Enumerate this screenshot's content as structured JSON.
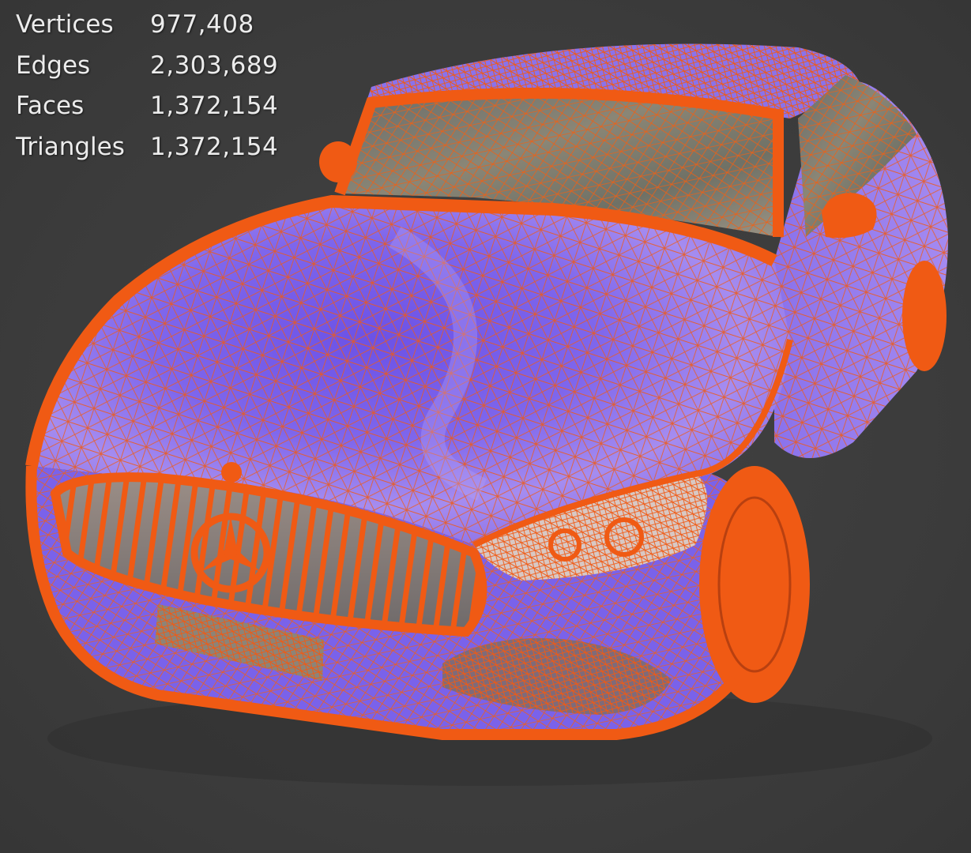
{
  "overlay": {
    "stats": [
      {
        "label": "Vertices",
        "value": "977,408"
      },
      {
        "label": "Edges",
        "value": "2,303,689"
      },
      {
        "label": "Faces",
        "value": "1,372,154"
      },
      {
        "label": "Triangles",
        "value": "1,372,154"
      }
    ]
  },
  "colors": {
    "background": "#3d3d3d",
    "wireframe": "#f05a14",
    "body_shading": "#7d62ea",
    "overlay_text": "#ececec"
  }
}
